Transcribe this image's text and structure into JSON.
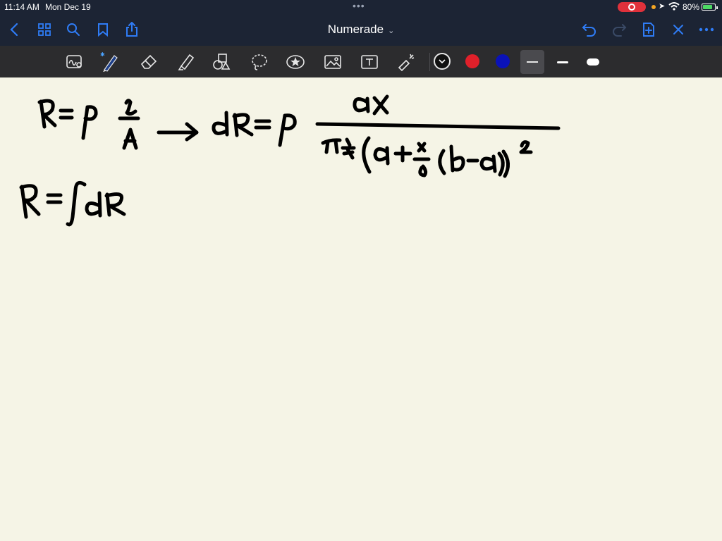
{
  "status_bar": {
    "time": "11:14 AM",
    "date": "Mon Dec 19",
    "battery_percent": "80%",
    "battery_level": 0.8
  },
  "nav_bar": {
    "title": "Numerade",
    "icons": [
      "back-icon",
      "grid-icon",
      "search-icon",
      "bookmark-icon",
      "share-icon",
      "undo-icon",
      "redo-icon",
      "add-page-icon",
      "close-icon",
      "more-icon"
    ]
  },
  "toolbar": {
    "tools": [
      "scribble-tool",
      "pen-tool",
      "eraser-tool",
      "highlighter-tool",
      "shapes-tool",
      "lasso-tool",
      "sticker-tool",
      "image-tool",
      "text-tool",
      "laser-pointer-tool"
    ],
    "colors": [
      "#111111",
      "#e0202a",
      "#0a12b8"
    ],
    "selected_color": "#111111",
    "stroke_sizes": [
      "thin",
      "medium",
      "thick"
    ],
    "selected_stroke": "thin"
  },
  "colors": {
    "chrome": "#1c2434",
    "toolbar": "#2c2c2e",
    "accent": "#2f7cf6",
    "paper": "#f5f4e6",
    "ink": "#000000"
  }
}
